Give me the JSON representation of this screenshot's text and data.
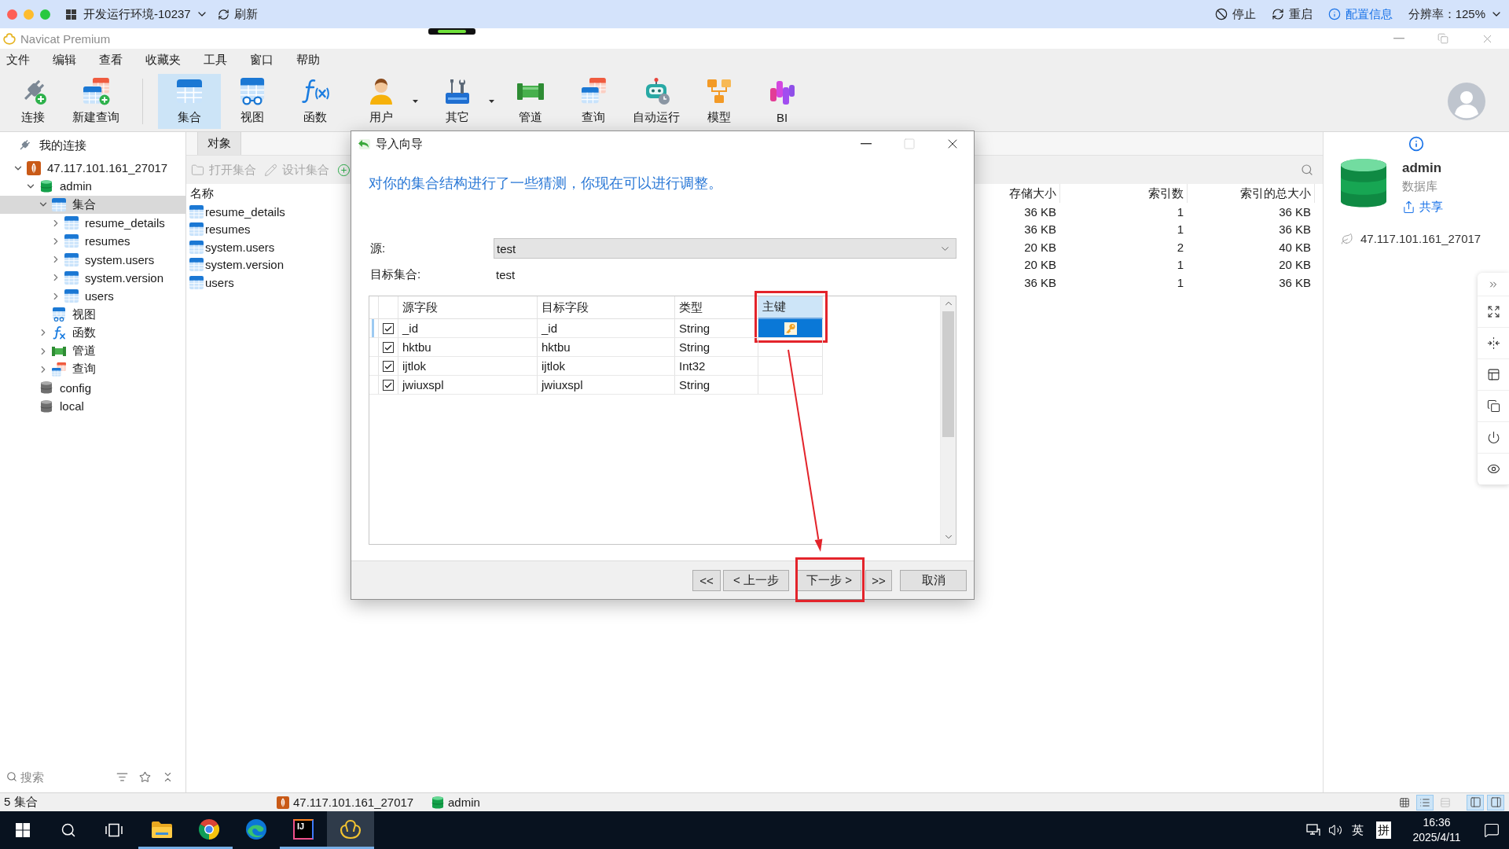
{
  "host_bar": {
    "environment": "开发运行环境-10237",
    "refresh": "刷新",
    "actions": [
      {
        "kind": "stop",
        "label": "停止"
      },
      {
        "kind": "restart",
        "label": "重启"
      },
      {
        "kind": "info",
        "label": "配置信息"
      }
    ],
    "resolution": "分辨率：125%"
  },
  "window": {
    "title": "Navicat Premium"
  },
  "menu": [
    "文件",
    "编辑",
    "查看",
    "收藏夹",
    "工具",
    "窗口",
    "帮助"
  ],
  "toolbar": {
    "groups": [
      [
        {
          "kind": "connect",
          "label": "连接",
          "selected": false,
          "dropdown": false
        },
        {
          "kind": "new_query",
          "label": "新建查询",
          "selected": false,
          "dropdown": false
        }
      ],
      [
        {
          "kind": "collection",
          "label": "集合",
          "selected": true,
          "dropdown": false
        },
        {
          "kind": "view",
          "label": "视图",
          "selected": false,
          "dropdown": false
        },
        {
          "kind": "function",
          "label": "函数",
          "selected": false,
          "dropdown": false
        },
        {
          "kind": "user",
          "label": "用户",
          "selected": false,
          "dropdown": true
        },
        {
          "kind": "other",
          "label": "其它",
          "selected": false,
          "dropdown": true
        },
        {
          "kind": "pipeline",
          "label": "管道",
          "selected": false,
          "dropdown": false
        },
        {
          "kind": "query",
          "label": "查询",
          "selected": false,
          "dropdown": false
        },
        {
          "kind": "automation",
          "label": "自动运行",
          "selected": false,
          "dropdown": false
        },
        {
          "kind": "model",
          "label": "模型",
          "selected": false,
          "dropdown": false
        },
        {
          "kind": "bi",
          "label": "BI",
          "selected": false,
          "dropdown": false
        }
      ]
    ]
  },
  "sidebar": {
    "title": "我的连接",
    "tree": [
      {
        "label": "47.117.101.161_27017",
        "kind": "server",
        "expanded": true,
        "selected": false,
        "children": [
          {
            "label": "admin",
            "kind": "database",
            "active": true,
            "expanded": true,
            "selected": false,
            "children": [
              {
                "label": "集合",
                "kind": "collections",
                "expanded": true,
                "selected": true,
                "children": [
                  {
                    "label": "resume_details",
                    "kind": "collection",
                    "expanded": false,
                    "selected": false
                  },
                  {
                    "label": "resumes",
                    "kind": "collection",
                    "expanded": false,
                    "selected": false
                  },
                  {
                    "label": "system.users",
                    "kind": "collection",
                    "expanded": false,
                    "selected": false
                  },
                  {
                    "label": "system.version",
                    "kind": "collection",
                    "expanded": false,
                    "selected": false
                  },
                  {
                    "label": "users",
                    "kind": "collection",
                    "expanded": false,
                    "selected": false
                  }
                ]
              },
              {
                "label": "视图",
                "kind": "views",
                "selected": false
              },
              {
                "label": "函数",
                "kind": "functions",
                "expanded": false,
                "selected": false
              },
              {
                "label": "管道",
                "kind": "pipelines",
                "expanded": false,
                "selected": false
              },
              {
                "label": "查询",
                "kind": "queries",
                "expanded": false,
                "selected": false
              }
            ]
          },
          {
            "label": "config",
            "kind": "database",
            "active": false,
            "selected": false
          },
          {
            "label": "local",
            "kind": "database",
            "active": false,
            "selected": false
          }
        ]
      }
    ],
    "search": {
      "placeholder": "搜索"
    }
  },
  "objects": {
    "tabs": [
      {
        "label": "对象",
        "selected": true
      }
    ],
    "actions": [
      {
        "kind": "open",
        "label": "打开集合",
        "disabled": true
      },
      {
        "kind": "design",
        "label": "设计集合",
        "disabled": true
      },
      {
        "kind": "add",
        "disabled": false
      }
    ],
    "columns": [
      "名称",
      "存储大小",
      "索引数",
      "索引的总大小"
    ],
    "rows": [
      {
        "name": "resume_details",
        "storage_size": "36 KB",
        "index_count": "1",
        "index_total_size": "36 KB"
      },
      {
        "name": "resumes",
        "storage_size": "36 KB",
        "index_count": "1",
        "index_total_size": "36 KB"
      },
      {
        "name": "system.users",
        "storage_size": "20 KB",
        "index_count": "2",
        "index_total_size": "40 KB"
      },
      {
        "name": "system.version",
        "storage_size": "20 KB",
        "index_count": "1",
        "index_total_size": "20 KB"
      },
      {
        "name": "users",
        "storage_size": "36 KB",
        "index_count": "1",
        "index_total_size": "36 KB"
      }
    ]
  },
  "info_panel": {
    "name": "admin",
    "type": "数据库",
    "share": "共享",
    "connection": "47.117.101.161_27017",
    "tools": [
      {
        "kind": "collapse"
      },
      {
        "kind": "fullscreen"
      },
      {
        "kind": "split"
      },
      {
        "kind": "layout"
      },
      {
        "kind": "copy"
      },
      {
        "kind": "power"
      },
      {
        "kind": "preview"
      }
    ]
  },
  "dialog": {
    "title": "导入向导",
    "controls": [
      {
        "kind": "minimize",
        "disabled": false
      },
      {
        "kind": "maximize",
        "disabled": true
      },
      {
        "kind": "close",
        "disabled": false
      }
    ],
    "heading": "对你的集合结构进行了一些猜测，你现在可以进行调整。",
    "source_label": "源:",
    "source_value": "test",
    "target_label": "目标集合:",
    "target_value": "test",
    "grid": {
      "columns": [
        {
          "label": "源字段",
          "selected": false,
          "annotated": false
        },
        {
          "label": "目标字段",
          "selected": false,
          "annotated": false
        },
        {
          "label": "类型",
          "selected": false,
          "annotated": false
        },
        {
          "label": "主键",
          "selected": true,
          "annotated": true
        }
      ],
      "rows": [
        {
          "include": true,
          "source": "_id",
          "target": "_id",
          "type": "String",
          "primary_key": true,
          "selected": true
        },
        {
          "include": true,
          "source": "hktbu",
          "target": "hktbu",
          "type": "String",
          "primary_key": false,
          "selected": false
        },
        {
          "include": true,
          "source": "ijtlok",
          "target": "ijtlok",
          "type": "Int32",
          "primary_key": false,
          "selected": false
        },
        {
          "include": true,
          "source": "jwiuxspl",
          "target": "jwiuxspl",
          "type": "String",
          "primary_key": false,
          "selected": false
        }
      ]
    },
    "buttons": [
      {
        "label": "<<",
        "annotated": false
      },
      {
        "label": "< 上一步",
        "annotated": false
      },
      {
        "label": "下一步 >",
        "annotated": true
      },
      {
        "label": ">>",
        "annotated": false
      },
      {
        "label": "取消",
        "annotated": false
      }
    ],
    "annotation_arrow": true
  },
  "status_bar": {
    "count": "5 集合",
    "connection": "47.117.101.161_27017",
    "database": "admin",
    "views": [
      {
        "kind": "grid",
        "selected": false,
        "disabled": false
      },
      {
        "kind": "list",
        "selected": true,
        "disabled": false
      },
      {
        "kind": "detail",
        "selected": false,
        "disabled": true
      }
    ],
    "panels": [
      {
        "kind": "left",
        "selected": true
      },
      {
        "kind": "right",
        "selected": true
      }
    ]
  },
  "taskbar": {
    "buttons": [
      {
        "kind": "start"
      },
      {
        "kind": "search"
      },
      {
        "kind": "task_view"
      }
    ],
    "apps": [
      {
        "kind": "explorer",
        "running": true,
        "active": false
      },
      {
        "kind": "chrome",
        "running": true,
        "active": false
      },
      {
        "kind": "edge",
        "running": false,
        "active": false
      },
      {
        "kind": "intellij",
        "label": "IJ",
        "running": true,
        "active": false
      },
      {
        "kind": "navicat",
        "running": true,
        "active": true
      }
    ],
    "tray": {
      "input_mode": "英",
      "ime": "拼",
      "time": "16:36",
      "date": "2025/4/11"
    }
  }
}
